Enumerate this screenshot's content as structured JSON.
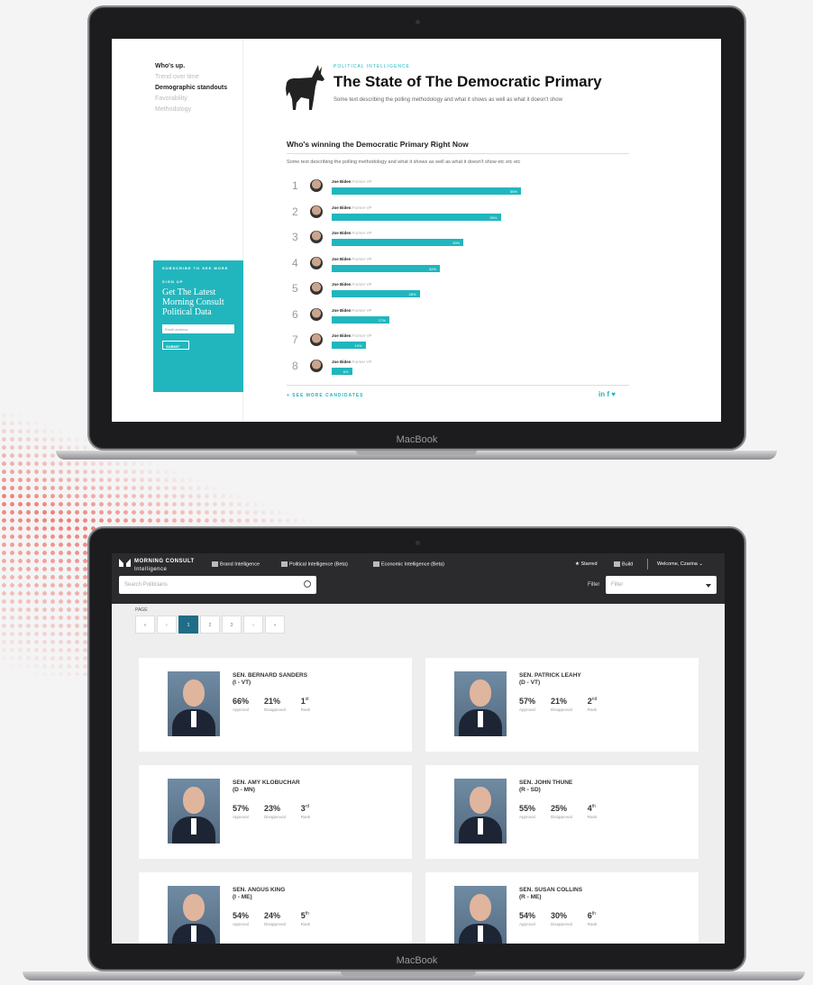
{
  "top": {
    "brand": "MacBook",
    "nav": [
      "Who's up.",
      "Trend over time",
      "Demographic standouts",
      "Favorability",
      "Methodology"
    ],
    "newsletter": {
      "kicker": "SUBSCRIBE TO SEE MORE",
      "label": "SIGN UP",
      "title": "Get The Latest Morning Consult Political Data",
      "input_placeholder": "Email address",
      "submit": "SUBMIT"
    },
    "kicker": "POLITICAL INTELLIGENCE",
    "title": "The State of The Democratic Primary",
    "subtitle": "Some text describing the polling methodology and what it shows as well as what it doesn't show",
    "section_title": "Who's winning the Democratic Primary Right Now",
    "section_text": "Some text describing the polling methodology and what it shows as well as what it doesn't show etc etc etc",
    "candidates": [
      {
        "rank": "1",
        "name": "Joe Biden",
        "role": "Former VP",
        "pct": 56,
        "label": "56%"
      },
      {
        "rank": "2",
        "name": "Joe Biden",
        "role": "Former VP",
        "pct": 50,
        "label": "50%"
      },
      {
        "rank": "3",
        "name": "Joe Biden",
        "role": "Former VP",
        "pct": 39,
        "label": "39%"
      },
      {
        "rank": "4",
        "name": "Joe Biden",
        "role": "Former VP",
        "pct": 32,
        "label": "32%"
      },
      {
        "rank": "5",
        "name": "Joe Biden",
        "role": "Former VP",
        "pct": 26,
        "label": "26%"
      },
      {
        "rank": "6",
        "name": "Joe Biden",
        "role": "Former VP",
        "pct": 17,
        "label": "17%"
      },
      {
        "rank": "7",
        "name": "Joe Biden",
        "role": "Former VP",
        "pct": 10,
        "label": "10%"
      },
      {
        "rank": "8",
        "name": "Joe Biden",
        "role": "Former VP",
        "pct": 6,
        "label": "6%"
      }
    ],
    "see_more": "+ SEE MORE CANDIDATES",
    "social": "in f ♥"
  },
  "bottom": {
    "brand": "MacBook",
    "logo": {
      "line1": "MORNING CONSULT",
      "line2": "Intelligence"
    },
    "nav": [
      "Brand Intelligence",
      "Political Intelligence (Beta)",
      "Economic Intelligence (Beta)"
    ],
    "starred": "Starred",
    "build": "Build",
    "welcome": "Welcome, Czarina",
    "search_placeholder": "Search Politicians",
    "filter_label": "Filter",
    "filter_placeholder": "Filter",
    "page_label": "PAGE",
    "pages": [
      "«",
      "‹",
      "1",
      "2",
      "3",
      "›",
      "»"
    ],
    "stat_labels": [
      "Approval",
      "Disapproval",
      "Rank"
    ],
    "senators": [
      {
        "name": "SEN. BERNARD SANDERS",
        "party": "(I - VT)",
        "approval": "66%",
        "disapproval": "21%",
        "rank": "1",
        "suffix": "st"
      },
      {
        "name": "SEN. PATRICK LEAHY",
        "party": "(D - VT)",
        "approval": "57%",
        "disapproval": "21%",
        "rank": "2",
        "suffix": "nd"
      },
      {
        "name": "SEN. AMY KLOBUCHAR",
        "party": "(D - MN)",
        "approval": "57%",
        "disapproval": "23%",
        "rank": "3",
        "suffix": "rd"
      },
      {
        "name": "SEN. JOHN THUNE",
        "party": "(R - SD)",
        "approval": "55%",
        "disapproval": "25%",
        "rank": "4",
        "suffix": "th"
      },
      {
        "name": "SEN. ANGUS KING",
        "party": "(I - ME)",
        "approval": "54%",
        "disapproval": "24%",
        "rank": "5",
        "suffix": "th"
      },
      {
        "name": "SEN. SUSAN COLLINS",
        "party": "(R - ME)",
        "approval": "54%",
        "disapproval": "30%",
        "rank": "6",
        "suffix": "th"
      }
    ]
  },
  "colors": {
    "accent": "#21b6bd",
    "pager_active": "#1f6d86",
    "dots": "#ec6b62"
  }
}
